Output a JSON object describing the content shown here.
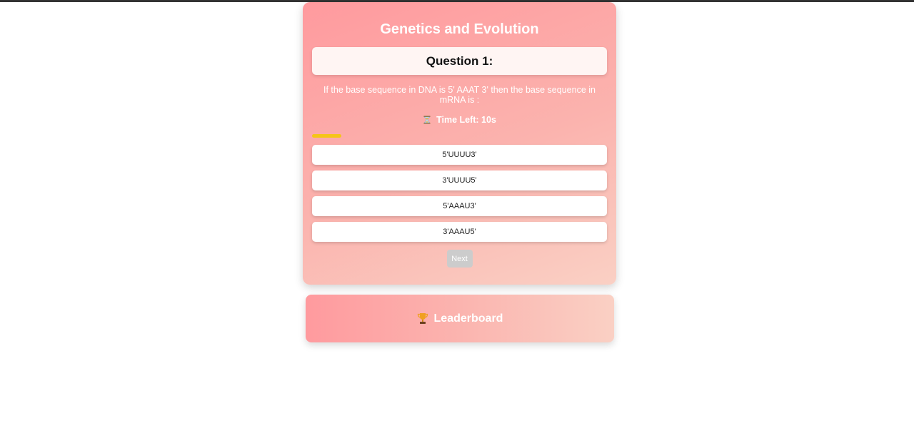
{
  "quiz": {
    "title": "Genetics and Evolution",
    "question_label": "Question 1:",
    "question_text": "If the base sequence in DNA is 5' AAAT 3' then the base sequence in mRNA is :",
    "timer_text": "Time Left: 10s",
    "timer_icon": "hourglass-icon",
    "time_progress_fraction": 0.1,
    "options": [
      {
        "label": "5'UUUU3'"
      },
      {
        "label": "3'UUUU5'"
      },
      {
        "label": "5'AAAU3'"
      },
      {
        "label": "3'AAAU5'"
      }
    ],
    "next_label": "Next"
  },
  "leaderboard": {
    "label": "Leaderboard",
    "icon": "trophy-icon"
  },
  "colors": {
    "card_gradient_start": "#ff9a9e",
    "card_gradient_end": "#fad0c4",
    "progress_fill": "#f5c518",
    "next_disabled": "#cccccc"
  }
}
